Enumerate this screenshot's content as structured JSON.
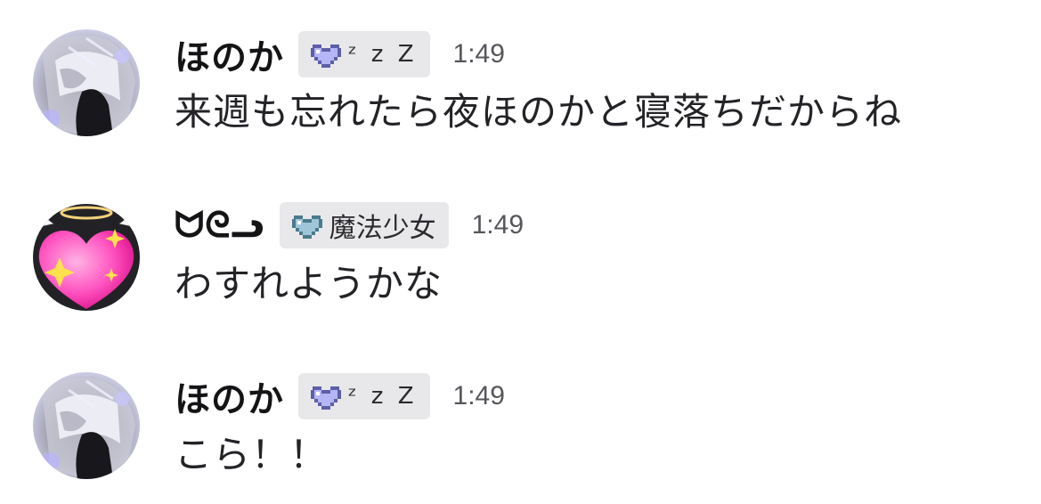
{
  "messages": [
    {
      "username": "ほのか",
      "badge": {
        "icon": "lavender-pixel-heart-icon",
        "text": "ᶻ z Z",
        "color": "#b4b6f5"
      },
      "time": "1:49",
      "text": "来週も忘れたら夜ほのかと寝落ちだからね",
      "avatar": "anime-girl-avatar"
    },
    {
      "username": "ᗢᘓᓗ",
      "badge": {
        "icon": "teal-pixel-heart-icon",
        "text": "魔法少女",
        "color": "#9ec6d8"
      },
      "time": "1:49",
      "text": "わすれようかな",
      "avatar": "pink-heart-angel-avatar"
    },
    {
      "username": "ほのか",
      "badge": {
        "icon": "lavender-pixel-heart-icon",
        "text": "ᶻ z Z",
        "color": "#b4b6f5"
      },
      "time": "1:49",
      "text": "こら！！",
      "avatar": "anime-girl-avatar"
    }
  ]
}
